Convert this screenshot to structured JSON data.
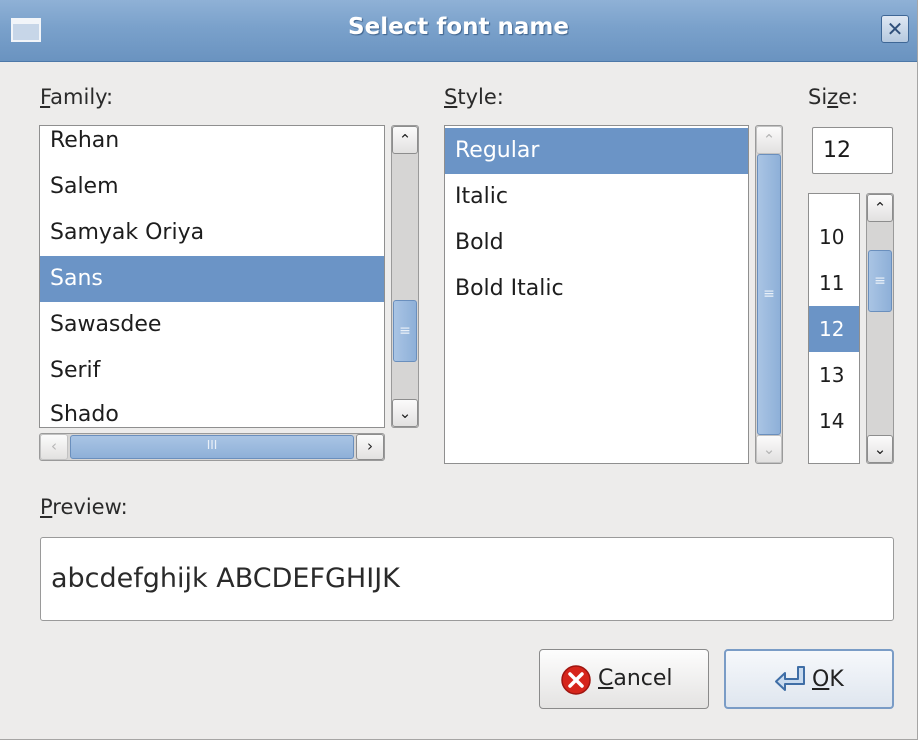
{
  "window": {
    "title": "Select font name",
    "menu_icon": "window-menu-icon",
    "close_icon": "close-icon",
    "close_glyph": "✕"
  },
  "family": {
    "label_mnemonic": "F",
    "label_rest": "amily:",
    "items": [
      "Rehan",
      "Salem",
      "Samyak Oriya",
      "Sans",
      "Sawasdee",
      "Serif",
      "Shado"
    ],
    "selected": "Sans"
  },
  "style": {
    "label_mnemonic": "S",
    "label_rest": "tyle:",
    "items": [
      "Regular",
      "Italic",
      "Bold",
      "Bold Italic"
    ],
    "selected": "Regular"
  },
  "size": {
    "label_pre": "Si",
    "label_mnemonic": "z",
    "label_rest": "e:",
    "value": "12",
    "items": [
      "10",
      "11",
      "12",
      "13",
      "14"
    ],
    "selected": "12"
  },
  "preview": {
    "label_mnemonic": "P",
    "label_rest": "review:",
    "text": "abcdefghijk ABCDEFGHIJK"
  },
  "buttons": {
    "cancel_mnemonic": "C",
    "cancel_rest": "ancel",
    "ok_mnemonic": "O",
    "ok_rest": "K"
  },
  "scroll": {
    "up_glyph": "⌃",
    "down_glyph": "⌄",
    "left_glyph": "‹",
    "right_glyph": "›",
    "grip_v": "≡",
    "grip_h": "III"
  },
  "colors": {
    "selection": "#6b94c6",
    "titlebar": "#7aa1cb",
    "cancel_icon": "#d6251b"
  }
}
